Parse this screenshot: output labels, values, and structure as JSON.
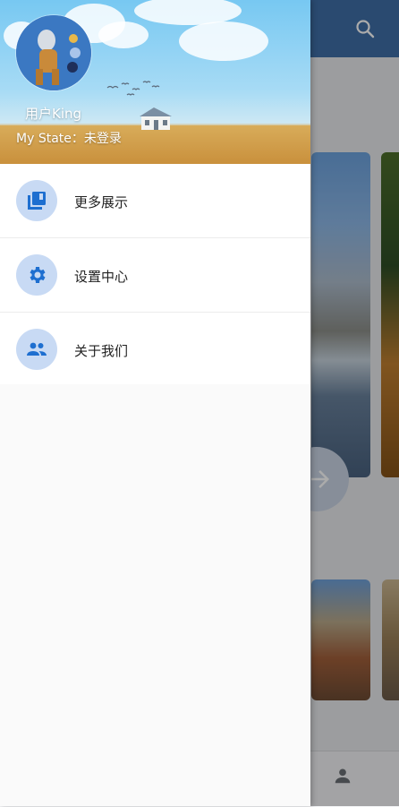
{
  "header": {
    "username": "用户King",
    "state_label": "My State：",
    "state_value": "未登录"
  },
  "menu": {
    "items": [
      {
        "label": "更多展示",
        "icon": "library-books-icon"
      },
      {
        "label": "设置中心",
        "icon": "settings-gear-icon"
      },
      {
        "label": "关于我们",
        "icon": "people-icon"
      }
    ]
  },
  "background_app": {
    "toolbar_icon": "search-icon",
    "fab_icon": "arrow-forward-icon",
    "bottom_nav_icon": "person-icon"
  },
  "colors": {
    "accent": "#1e6fd0",
    "icon_bg": "#c8daf4",
    "app_bar": "#3f6fa8"
  }
}
